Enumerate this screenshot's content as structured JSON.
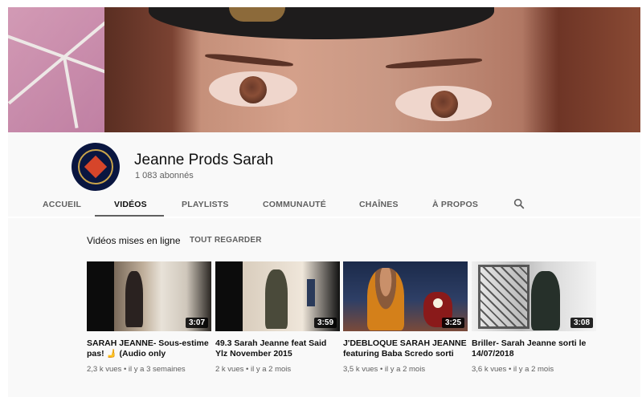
{
  "channel": {
    "name": "Jeanne Prods Sarah",
    "subscribers": "1 083 abonnés"
  },
  "tabs": [
    "ACCUEIL",
    "VIDÉOS",
    "PLAYLISTS",
    "COMMUNAUTÉ",
    "CHAÎNES",
    "À PROPOS"
  ],
  "active_tab": "VIDÉOS",
  "section": {
    "title": "Vidéos mises en ligne",
    "see_all": "TOUT REGARDER"
  },
  "videos": [
    {
      "title": "SARAH JEANNE- Sous-estime pas! 🫸 (Audio only",
      "duration": "3:07",
      "views": "2,3 k vues",
      "age": "il y a 3 semaines"
    },
    {
      "title": "49.3 Sarah Jeanne feat Said Ylz November 2015",
      "duration": "3:59",
      "views": "2 k vues",
      "age": "il y a 2 mois"
    },
    {
      "title": "J'DEBLOQUE SARAH JEANNE featuring Baba Scredo sorti",
      "duration": "3:25",
      "views": "3,5 k vues",
      "age": "il y a 2 mois"
    },
    {
      "title": "Briller- Sarah Jeanne sorti le 14/07/2018",
      "duration": "3:08",
      "views": "3,6 k vues",
      "age": "il y a 2 mois"
    }
  ],
  "meta_separator": " • ",
  "icons": {
    "search": "search-icon"
  }
}
